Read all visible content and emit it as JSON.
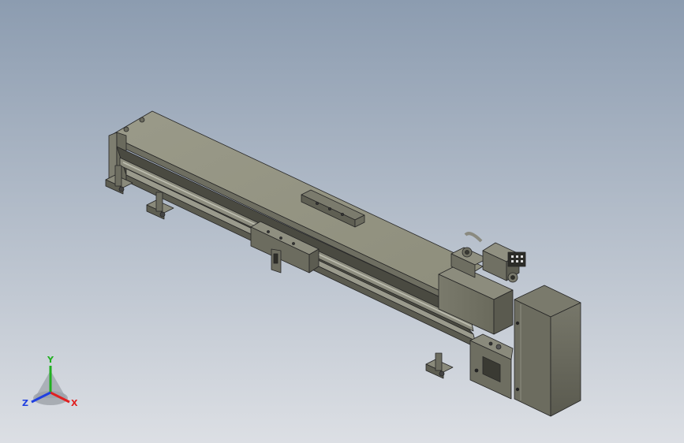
{
  "viewport": {
    "background_top": "#8c9cb0",
    "background_bottom": "#dcdfe4"
  },
  "model": {
    "body_color": "#8a8a78",
    "body_top_color": "#999988",
    "body_dark_color": "#5e5e52",
    "outline_color": "#262626"
  },
  "triad": {
    "x_label": "X",
    "y_label": "Y",
    "z_label": "Z",
    "x_color": "#e02020",
    "y_color": "#20b020",
    "z_color": "#2040e0"
  }
}
